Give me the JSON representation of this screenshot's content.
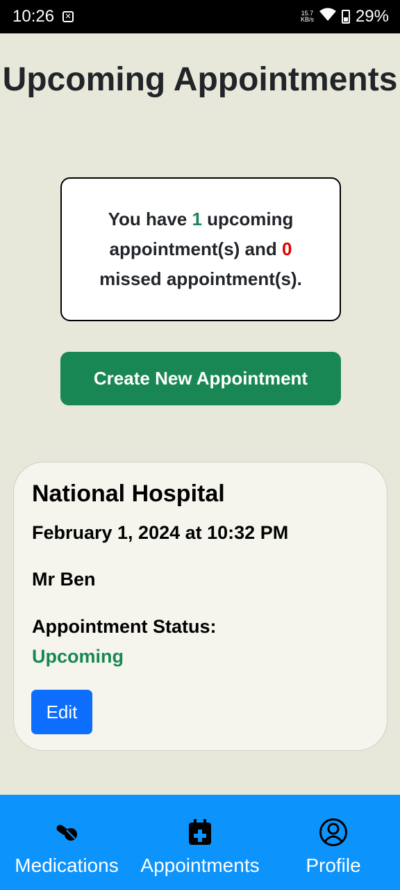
{
  "status_bar": {
    "time": "10:26",
    "net_speed_value": "15.7",
    "net_speed_unit": "KB/s",
    "battery": "29%"
  },
  "page": {
    "title": "Upcoming Appointments"
  },
  "summary": {
    "prefix": "You have ",
    "upcoming_count": "1",
    "middle": " upcoming appointment(s) and ",
    "missed_count": "0",
    "suffix": " missed appointment(s)."
  },
  "create_button": {
    "label": "Create New Appointment"
  },
  "appointments": [
    {
      "location": "National Hospital",
      "datetime": "February 1, 2024 at 10:32 PM",
      "doctor": "Mr Ben",
      "status_label": "Appointment Status:",
      "status_value": "Upcoming",
      "edit_label": "Edit"
    }
  ],
  "bottom_nav": {
    "items": [
      {
        "label": "Medications",
        "icon": "pills-icon"
      },
      {
        "label": "Appointments",
        "icon": "calendar-plus-icon"
      },
      {
        "label": "Profile",
        "icon": "user-circle-icon"
      }
    ]
  },
  "colors": {
    "background": "#e8e8da",
    "accent_green": "#198754",
    "missed_red": "#e00000",
    "edit_blue": "#0d6efd",
    "nav_blue": "#0d93fc"
  }
}
